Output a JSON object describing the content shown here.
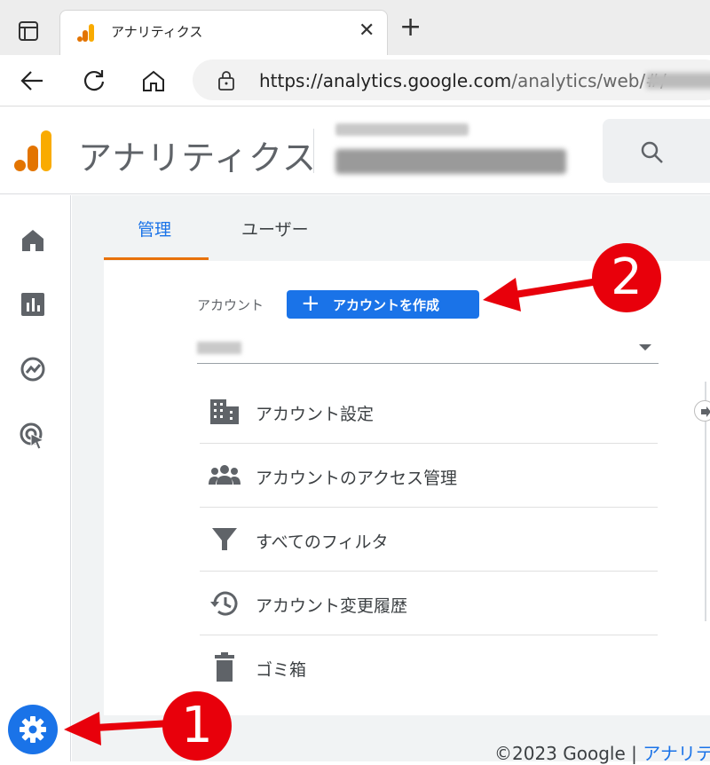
{
  "browser": {
    "tab_title": "アナリティクス",
    "tab_close": "✕",
    "new_tab": "+",
    "url_host": "https://analytics.google.com",
    "url_path": "/analytics/web/#/",
    "colors": {
      "ga_orange": "#f9ab00",
      "ga_dark_orange": "#e37400"
    }
  },
  "header": {
    "app_title": "アナリティクス"
  },
  "rail": {
    "items": [
      "home-icon",
      "reports-icon",
      "explore-icon",
      "advertising-icon"
    ],
    "settings_icon": "gear-icon"
  },
  "tabs": [
    {
      "label": "管理",
      "active": true
    },
    {
      "label": "ユーザー",
      "active": false
    }
  ],
  "account": {
    "label": "アカウント",
    "create_button": "アカウントを作成",
    "create_plus": "+"
  },
  "menu": [
    {
      "label": "アカウント設定",
      "icon": "building-icon"
    },
    {
      "label": "アカウントのアクセス管理",
      "icon": "people-icon"
    },
    {
      "label": "すべてのフィルタ",
      "icon": "filter-icon"
    },
    {
      "label": "アカウント変更履歴",
      "icon": "history-icon"
    },
    {
      "label": "ゴミ箱",
      "icon": "trash-icon"
    }
  ],
  "footer": {
    "copyright": "©2023 Google | ",
    "link": "アナリテ"
  },
  "annotations": {
    "badge1": "1",
    "badge2": "2",
    "color": "#e8000b"
  }
}
